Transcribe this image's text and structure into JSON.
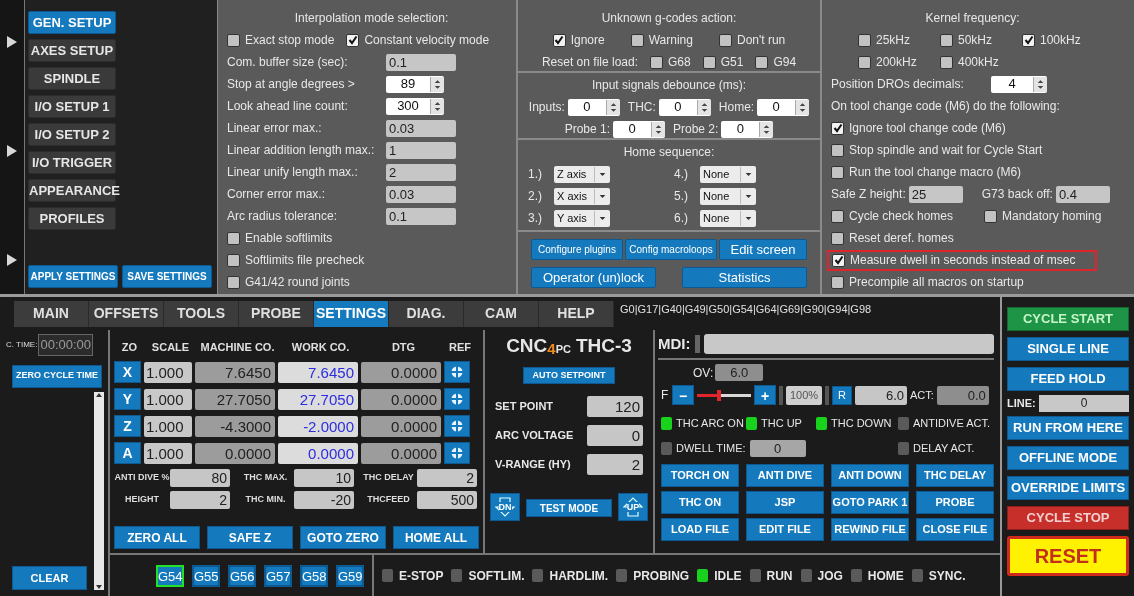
{
  "settings_nav": {
    "items": [
      {
        "label": "GEN. SETUP",
        "selected": true
      },
      {
        "label": "AXES SETUP",
        "selected": false
      },
      {
        "label": "SPINDLE",
        "selected": false
      },
      {
        "label": "I/O SETUP 1",
        "selected": false
      },
      {
        "label": "I/O SETUP 2",
        "selected": false
      },
      {
        "label": "I/O TRIGGER",
        "selected": false
      },
      {
        "label": "APPEARANCE",
        "selected": false
      },
      {
        "label": "PROFILES",
        "selected": false
      }
    ],
    "actions": [
      "APPLY SETTINGS",
      "SAVE SETTINGS"
    ]
  },
  "interpolation": {
    "title": "Interpolation mode selection:",
    "modes": [
      {
        "label": "Exact stop mode",
        "checked": false
      },
      {
        "label": "Constant velocity mode",
        "checked": true
      }
    ],
    "fields": [
      {
        "label": "Com. buffer size (sec):",
        "value": "0.1",
        "kind": "text"
      },
      {
        "label": "Stop at angle degrees >",
        "value": "89",
        "kind": "spin"
      },
      {
        "label": "Look ahead line count:",
        "value": "300",
        "kind": "spin"
      },
      {
        "label": "Linear error max.:",
        "value": "0.03",
        "kind": "text"
      },
      {
        "label": "Linear addition length max.:",
        "value": "1",
        "kind": "text"
      },
      {
        "label": "Linear unify length max.:",
        "value": "2",
        "kind": "text"
      },
      {
        "label": "Corner error max.:",
        "value": "0.03",
        "kind": "text"
      },
      {
        "label": "Arc radius tolerance:",
        "value": "0.1",
        "kind": "text"
      }
    ],
    "options": [
      {
        "label": "Enable softlimits",
        "checked": false
      },
      {
        "label": "Softlimits file precheck",
        "checked": false
      },
      {
        "label": "G41/42 round joints",
        "checked": false
      }
    ]
  },
  "gcodes": {
    "title": "Unknown g-codes action:",
    "actions": [
      {
        "label": "Ignore",
        "checked": true
      },
      {
        "label": "Warning",
        "checked": false
      },
      {
        "label": "Don't run",
        "checked": false
      }
    ],
    "reset_label": "Reset on file load:",
    "reset": [
      {
        "label": "G68",
        "checked": false
      },
      {
        "label": "G51",
        "checked": false
      },
      {
        "label": "G94",
        "checked": false
      }
    ]
  },
  "debounce": {
    "title": "Input signals debounce (ms):",
    "rows": [
      [
        {
          "label": "Inputs:",
          "value": "0"
        },
        {
          "label": "THC:",
          "value": "0"
        },
        {
          "label": "Home:",
          "value": "0"
        }
      ],
      [
        {
          "label": "Probe 1:",
          "value": "0"
        },
        {
          "label": "Probe 2:",
          "value": "0"
        }
      ]
    ]
  },
  "home_sequence": {
    "title": "Home sequence:",
    "steps": [
      {
        "label": "1.)",
        "value": "Z axis"
      },
      {
        "label": "4.)",
        "value": "None"
      },
      {
        "label": "2.)",
        "value": "X axis"
      },
      {
        "label": "5.)",
        "value": "None"
      },
      {
        "label": "3.)",
        "value": "Y axis"
      },
      {
        "label": "6.)",
        "value": "None"
      }
    ]
  },
  "tool_buttons": [
    [
      "Configure plugins",
      "Config macroloops",
      "Edit screen"
    ],
    [
      "Operator (un)lock",
      "Statistics"
    ]
  ],
  "kernel": {
    "title": "Kernel frequency:",
    "options": [
      [
        {
          "label": "25kHz",
          "checked": false
        },
        {
          "label": "50kHz",
          "checked": false
        },
        {
          "label": "100kHz",
          "checked": true
        }
      ],
      [
        {
          "label": "200kHz",
          "checked": false
        },
        {
          "label": "400kHz",
          "checked": false
        }
      ]
    ]
  },
  "misc": {
    "decimals_label": "Position DROs decimals:",
    "decimals": "4",
    "tool_change_title": "On tool change code (M6) do the following:",
    "tool_change": [
      {
        "label": "Ignore tool change code (M6)",
        "checked": true
      },
      {
        "label": "Stop spindle and wait for Cycle Start",
        "checked": false
      },
      {
        "label": "Run the tool change macro (M6)",
        "checked": false
      }
    ],
    "safe_z_label": "Safe Z height:",
    "safe_z": "25",
    "g73_label": "G73 back off:",
    "g73": "0.4",
    "homes": [
      {
        "label": "Cycle check homes",
        "checked": false
      },
      {
        "label": "Mandatory homing",
        "checked": false
      }
    ],
    "options": [
      {
        "label": "Reset deref. homes",
        "checked": false,
        "highlighted": false
      },
      {
        "label": "Measure dwell in seconds instead of msec",
        "checked": true,
        "highlighted": true
      },
      {
        "label": "Precompile all macros on startup",
        "checked": false,
        "highlighted": false
      }
    ]
  },
  "tabs": [
    {
      "label": "MAIN",
      "selected": false
    },
    {
      "label": "OFFSETS",
      "selected": false
    },
    {
      "label": "TOOLS",
      "selected": false
    },
    {
      "label": "PROBE",
      "selected": false
    },
    {
      "label": "SETTINGS",
      "selected": true
    },
    {
      "label": "DIAG.",
      "selected": false
    },
    {
      "label": "CAM",
      "selected": false
    },
    {
      "label": "HELP",
      "selected": false
    }
  ],
  "modal_codes": "G0|G17|G40|G49|G50|G54|G64|G69|G90|G94|G98",
  "cycle_time": {
    "label": "C. TIME:",
    "value": "00:00:00",
    "zero_button": "ZERO CYCLE TIME",
    "clear_button": "CLEAR"
  },
  "dro": {
    "columns": [
      "ZO",
      "SCALE",
      "MACHINE CO.",
      "WORK CO.",
      "DTG",
      "REF"
    ],
    "rows": [
      {
        "axis": "X",
        "scale": "1.000",
        "machine": "7.6450",
        "work": "7.6450",
        "dtg": "0.0000"
      },
      {
        "axis": "Y",
        "scale": "1.000",
        "machine": "27.7050",
        "work": "27.7050",
        "dtg": "0.0000"
      },
      {
        "axis": "Z",
        "scale": "1.000",
        "machine": "-4.3000",
        "work": "-2.0000",
        "dtg": "0.0000"
      },
      {
        "axis": "A",
        "scale": "1.000",
        "machine": "0.0000",
        "work": "0.0000",
        "dtg": "0.0000"
      }
    ],
    "params": [
      {
        "label": "ANTI DIVE %",
        "value": "80"
      },
      {
        "label": "THC MAX.",
        "value": "10"
      },
      {
        "label": "THC DELAY",
        "value": "2"
      },
      {
        "label": "HEIGHT",
        "value": "2"
      },
      {
        "label": "THC MIN.",
        "value": "-20"
      },
      {
        "label": "THCFEED",
        "value": "500"
      }
    ],
    "buttons": [
      "ZERO ALL",
      "SAFE Z",
      "GOTO ZERO",
      "HOME ALL"
    ]
  },
  "offsets": [
    {
      "label": "G54",
      "selected": true
    },
    {
      "label": "G55",
      "selected": false
    },
    {
      "label": "G56",
      "selected": false
    },
    {
      "label": "G57",
      "selected": false
    },
    {
      "label": "G58",
      "selected": false
    },
    {
      "label": "G59",
      "selected": false
    }
  ],
  "status": [
    {
      "label": "E-STOP",
      "on": false
    },
    {
      "label": "SOFTLIM.",
      "on": false
    },
    {
      "label": "HARDLIM.",
      "on": false
    },
    {
      "label": "PROBING",
      "on": false
    },
    {
      "label": "IDLE",
      "on": true
    },
    {
      "label": "RUN",
      "on": false
    },
    {
      "label": "JOG",
      "on": false
    },
    {
      "label": "HOME",
      "on": false
    },
    {
      "label": "SYNC.",
      "on": false
    }
  ],
  "thc": {
    "logo_prefix": "CNC",
    "logo_mark": "4",
    "logo_suffix": "PC",
    "model": "THC-3",
    "auto_setpoint": "AUTO SETPOINT",
    "fields": [
      {
        "label": "SET POINT",
        "value": "120"
      },
      {
        "label": "ARC VOLTAGE",
        "value": "0"
      },
      {
        "label": "V-RANGE (HY)",
        "value": "2"
      }
    ],
    "down_label": "DN",
    "up_label": "UP",
    "test_mode": "TEST MODE"
  },
  "mdi": {
    "label": "MDI:"
  },
  "feed": {
    "ov_label": "OV:",
    "ov": "6.0",
    "f_label": "F",
    "minus": "−",
    "plus": "+",
    "level": 0.4,
    "percent": "100%",
    "reset": "R",
    "value": "6.0",
    "act_label": "ACT:",
    "act": "0.0"
  },
  "indicators": [
    {
      "label": "THC ARC ON",
      "on": true
    },
    {
      "label": "THC UP",
      "on": true
    },
    {
      "label": "THC DOWN",
      "on": true
    },
    {
      "label": "ANTIDIVE ACT.",
      "on": false
    }
  ],
  "dwell": {
    "label": "DWELL TIME:",
    "on": false,
    "value": "0"
  },
  "delay_act": {
    "label": "DELAY ACT.",
    "on": false
  },
  "action_buttons": [
    "TORCH ON",
    "ANTI DIVE",
    "ANTI DOWN",
    "THC DELAY",
    "THC ON",
    "JSP",
    "GOTO PARK 1",
    "PROBE",
    "LOAD FILE",
    "EDIT FILE",
    "REWIND FILE",
    "CLOSE FILE"
  ],
  "cycle_controls": [
    {
      "kind": "start",
      "label": "CYCLE START"
    },
    {
      "kind": "normal",
      "label": "SINGLE LINE"
    },
    {
      "kind": "normal",
      "label": "FEED HOLD"
    },
    {
      "kind": "line",
      "label": "LINE:",
      "value": "0"
    },
    {
      "kind": "normal",
      "label": "RUN FROM HERE"
    },
    {
      "kind": "normal",
      "label": "OFFLINE MODE"
    },
    {
      "kind": "normal",
      "label": "OVERRIDE LIMITS"
    },
    {
      "kind": "stop",
      "label": "CYCLE STOP"
    },
    {
      "kind": "reset",
      "label": "RESET"
    }
  ]
}
